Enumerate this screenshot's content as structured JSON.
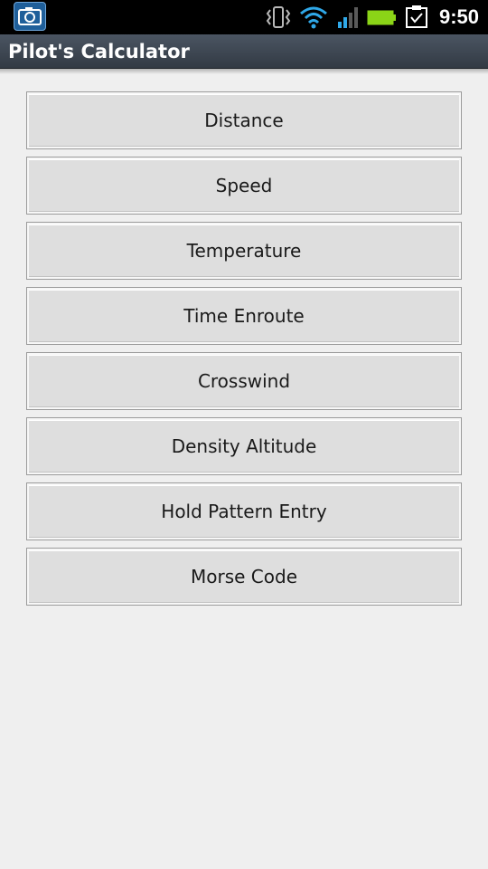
{
  "status_bar": {
    "time": "9:50",
    "icons": [
      "camera-icon",
      "vibrate-icon",
      "wifi-icon",
      "signal-icon",
      "battery-icon",
      "task-icon"
    ]
  },
  "app": {
    "title": "Pilot's Calculator"
  },
  "menu": {
    "items": [
      {
        "label": "Distance"
      },
      {
        "label": "Speed"
      },
      {
        "label": "Temperature"
      },
      {
        "label": "Time Enroute"
      },
      {
        "label": "Crosswind"
      },
      {
        "label": "Density Altitude"
      },
      {
        "label": "Hold Pattern Entry"
      },
      {
        "label": "Morse Code"
      }
    ]
  },
  "colors": {
    "status_bg": "#000000",
    "title_bg": "#3f4853",
    "page_bg": "#efefef",
    "button_bg": "#dedede",
    "wifi": "#2fa8e8",
    "battery": "#8bd417"
  }
}
